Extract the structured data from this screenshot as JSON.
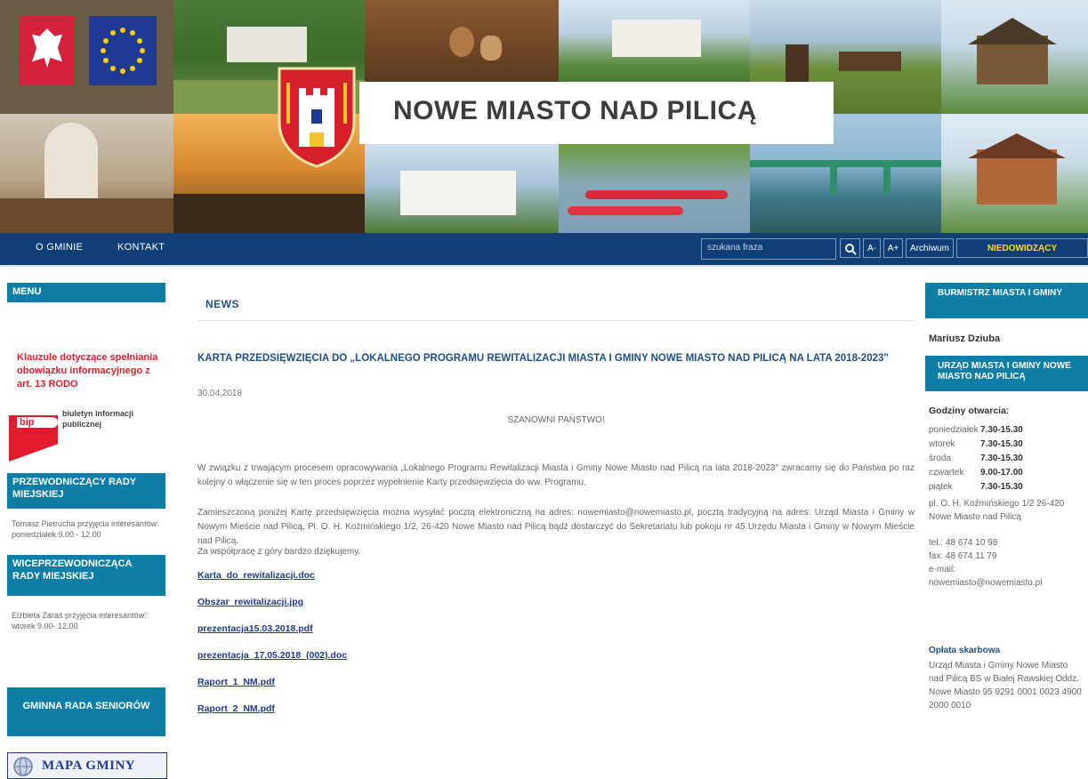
{
  "header": {
    "site_title": "NOWE MIASTO NAD PILICĄ"
  },
  "nav": {
    "items": [
      "O GMINIE",
      "KONTAKT"
    ],
    "search_placeholder": "szukana fraza",
    "font_decrease": "A-",
    "font_increase": "A+",
    "archive": "Archiwum",
    "accessibility": "NIEDOWIDZĄCY"
  },
  "left": {
    "menu_title": "MENU",
    "rodo_link": "Klauzule dotyczące spełniania obowiązku informacyjnego z art. 13 RODO",
    "bip_short": "bip",
    "bip_text": "biuletyn informacji publicznej",
    "chairman_title": "PRZEWODNICZĄCY RADY MIEJSKIEJ",
    "chairman_info": "Tomasz Pietrucha przyjęcia interesantów: poniedziałek 9.00 - 12.00",
    "vice_title": "WICEPRZEWODNICZĄCA RADY MIEJSKIEJ",
    "vice_info": "Elżbieta Zaraś przyjęcia interesantów: wtorek 9.00- 12.00",
    "seniors": "GMINNA RADA SENIORÓW",
    "map": "MAPA GMINY"
  },
  "main": {
    "section": "NEWS",
    "article_title": "KARTA PRZEDSIĘWZIĘCIA DO „LOKALNEGO PROGRAMU REWITALIZACJI MIASTA I GMINY NOWE MIASTO NAD PILICĄ NA LATA 2018-2023\"",
    "date": "30.04.2018",
    "greeting": "SZANOWNI PAŃSTWO!",
    "para1": "W związku z trwającym procesem opracowywania „Lokalnego Programu Rewitalizacji Miasta i Gminy Nowe Miasto nad Pilicą na lata 2018-2023\" zwracamy się do Państwa po raz kolejny o włączenie się w ten proces poprzez wypełnienie Karty przedsięwzięcia do ww. Programu.",
    "para2": "Zamieszczoną poniżej Kartę przedsięwzięcia można wysyłać pocztą elektroniczną na adres: nowemiasto@nowemiasto.pl, pocztą tradycyjną na adres: Urząd Miasta i Gminy w Nowym Mieście nad Pilicą, Pl. O. H. Koźmińskiego 1/2, 26-420 Nowe Miasto nad Pilicą bądź dostarczyć do Sekretariatu lub pokoju nr 45 Urzędu Miasta i Gminy w Nowym Mieście nad Pilicą.",
    "para3": "Za współpracę z góry bardzo dziękujemy.",
    "files": [
      "Karta_do_rewitalizacji.doc",
      "Obszar_rewitalizacji.jpg",
      "prezentacja15.03.2018.pdf",
      "prezentacja_17.05.2018_(002).doc",
      "Raport_1_NM.pdf",
      "Raport_2_NM.pdf"
    ]
  },
  "right": {
    "mayor_title": "BURMISTRZ MIASTA I GMINY",
    "mayor_name": "Mariusz Dziuba",
    "office_title": "URZĄD MIASTA I GMINY NOWE MIASTO NAD PILICĄ",
    "hours_label": "Godziny otwarcia:",
    "hours": [
      {
        "day": "poniedziałek",
        "time": "7.30-15.30"
      },
      {
        "day": "wtorek",
        "time": "7.30-15.30"
      },
      {
        "day": "środa",
        "time": "7.30-15.30"
      },
      {
        "day": "czwartek",
        "time": "9.00-17.00"
      },
      {
        "day": "piątek",
        "time": "7.30-15.30"
      }
    ],
    "address": "pl. O. H. Koźmińskiego 1/2 26-420 Nowe Miasto nad Pilicą",
    "tel": "tel.: 48 674 10 98",
    "fax": "fax: 48 674 11 79",
    "email_label": "e-mail:",
    "email": "nowemiasto@nowemiasto.pl",
    "fee_title": "Opłata skarbowa",
    "fee_info": "Urząd Miasta i Gminy Nowe Miasto nad Pilicą BS w Białej Rawskiej Oddz. Nowe Miasto 95 9291 0001 0023 4900 2000 0010"
  }
}
